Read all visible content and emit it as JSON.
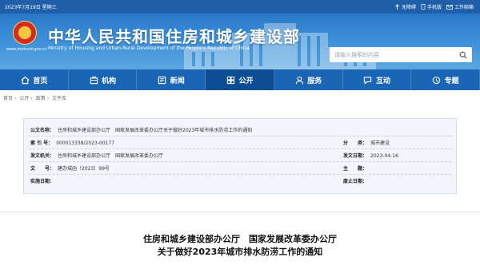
{
  "topbar": {
    "date": "2023年7月19日 星期三",
    "accessibility": "无障碍",
    "mobile": "手机版",
    "mail": "工作邮箱"
  },
  "header": {
    "title_cn": "中华人民共和国住房和城乡建设部",
    "title_en": "Ministry of Housing and Urban-Rural Development of the People's Republic of China",
    "site_url": "www.mohurd.gov.cn",
    "search_placeholder": "请输入搜索的内容"
  },
  "nav": [
    {
      "label": "首页",
      "icon": "home-icon",
      "active": false
    },
    {
      "label": "机构",
      "icon": "org-icon",
      "active": false
    },
    {
      "label": "新闻",
      "icon": "news-icon",
      "active": false
    },
    {
      "label": "公开",
      "icon": "public-icon",
      "active": true
    },
    {
      "label": "服务",
      "icon": "service-icon",
      "active": false
    },
    {
      "label": "互动",
      "icon": "chat-icon",
      "active": false
    },
    {
      "label": "专题",
      "icon": "topic-icon",
      "active": false
    }
  ],
  "breadcrumb": [
    "首页",
    "公开",
    "政策",
    "文件库"
  ],
  "meta": {
    "issuer_label": "公文名称：",
    "issuer_value": "住房和城乡建设部办公厅　国家发展改革委办公厅关于做好2023年城市排水防涝工作的通知",
    "index_label": "索 引 号：",
    "index_value": "000013338/2023-00177",
    "category_label": "分　　类：",
    "category_value": "城市建设",
    "org_label": "发文机关：",
    "org_value": "住房和城乡建设部办公厅　国家发展改革委办公厅",
    "date_label": "发文日期：",
    "date_value": "2023-04-16",
    "number_label": "文　　号：",
    "number_value": "建办城函〔2023〕99号",
    "status_label": "主　　题：",
    "status_value": "",
    "impl_label": "实施日期：",
    "impl_value": "",
    "expire_label": "废止日期：",
    "expire_value": ""
  },
  "doc": {
    "title_line1": "住房和城乡建设部办公厅　国家发展改革委办公厅",
    "title_line2": "关于做好2023年城市排水防涝工作的通知"
  }
}
